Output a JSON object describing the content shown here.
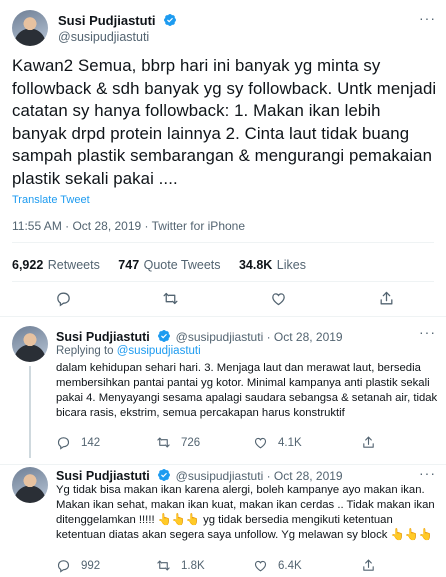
{
  "main": {
    "author": {
      "name": "Susi Pudjiastuti",
      "handle": "@susipudjiastuti"
    },
    "text": "Kawan2 Semua, bbrp hari ini banyak yg minta sy followback & sdh banyak yg sy followback. Untk menjadi catatan sy hanya followback: 1. Makan ikan lebih banyak drpd protein lainnya 2. Cinta laut tidak buang sampah plastik sembarangan & mengurangi pemakaian plastik sekali pakai ....",
    "translate_label": "Translate Tweet",
    "meta": "11:55 AM · Oct 28, 2019 · Twitter for iPhone",
    "stats": {
      "retweets_count": "6,922",
      "retweets_label": "Retweets",
      "quotes_count": "747",
      "quotes_label": "Quote Tweets",
      "likes_count": "34.8K",
      "likes_label": "Likes"
    }
  },
  "replies": [
    {
      "name": "Susi Pudjiastuti",
      "handle_date": "@susipudjiastuti · Oct 28, 2019",
      "replying_label": "Replying to",
      "replying_handle": "@susipudjiastuti",
      "text": "dalam kehidupan sehari hari. 3. Menjaga laut dan merawat laut, bersedia membersihkan pantai pantai yg kotor. Minimal kampanya anti plastik sekali pakai 4. Menyayangi sesama apalagi saudara sebangsa & setanah air, tidak bicara rasis, ekstrim, semua percakapan harus konstruktif",
      "reply_count": "142",
      "retweet_count": "726",
      "like_count": "4.1K"
    },
    {
      "name": "Susi Pudjiastuti",
      "handle_date": "@susipudjiastuti · Oct 28, 2019",
      "text": "Yg tidak bisa makan ikan karena alergi, boleh kampanye ayo makan ikan. Makan ikan sehat, makan ikan kuat, makan ikan cerdas .. Tidak makan ikan ditenggelamkan !!!!! 👆👆👆 yg tidak bersedia mengikuti ketentuan ketentuan diatas akan segera saya unfollow. Yg melawan sy block 👆👆👆",
      "reply_count": "992",
      "retweet_count": "1.8K",
      "like_count": "6.4K"
    }
  ],
  "icons": {
    "verified": "verified-badge-icon",
    "reply": "reply-icon",
    "retweet": "retweet-icon",
    "like": "heart-icon",
    "share": "share-icon",
    "more": "more-icon"
  },
  "colors": {
    "accent": "#1d9bf0",
    "muted": "#536471",
    "text": "#0f1419",
    "divider": "#eff3f4"
  }
}
